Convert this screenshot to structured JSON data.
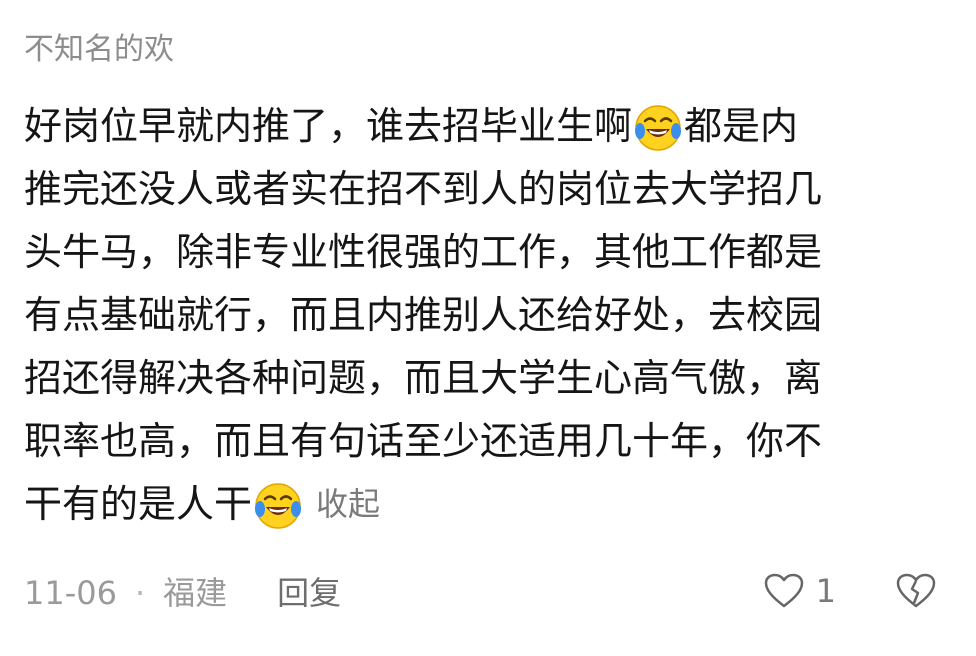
{
  "comment": {
    "username": "不知名的欢",
    "lines": [
      {
        "text_before": "好岗位早就内推了，谁去招毕业生啊",
        "emoji": "face-with-tears-of-joy",
        "text_after": "都是内"
      },
      {
        "text": "推完还没人或者实在招不到人的岗位去大学招几"
      },
      {
        "text": "头牛马，除非专业性很强的工作，其他工作都是"
      },
      {
        "text": "有点基础就行，而且内推别人还给好处，去校园"
      },
      {
        "text": "招还得解决各种问题，而且大学生心高气傲，离"
      },
      {
        "text": "职率也高，而且有句话至少还适用几十年，你不"
      },
      {
        "text_before": "干有的是人干",
        "emoji": "face-with-tears-of-joy",
        "collapse_label": "收起"
      }
    ],
    "date": "11-06",
    "separator": "·",
    "location": "福建",
    "reply_label": "回复",
    "like_count": "1",
    "icons": {
      "like": "heart-outline-icon",
      "dislike": "broken-heart-icon"
    },
    "colors": {
      "emoji_face": "#ffd21f",
      "emoji_tears": "#3b8eea",
      "text": "#151515",
      "muted": "#8d8d8d"
    }
  }
}
